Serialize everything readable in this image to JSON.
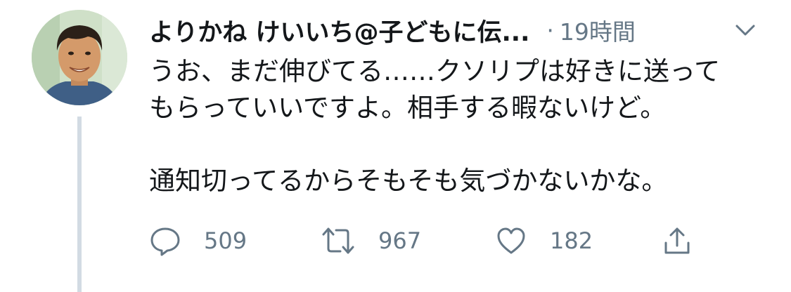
{
  "tweet": {
    "display_name": "よりかね けいいち@子どもに伝...",
    "separator": "·",
    "time": "19時間",
    "text_lines": [
      "うお、まだ伸びてる……クソリプは好きに送って",
      "もらっていいですよ。相手する暇ないけど。"
    ],
    "text_line_3": "通知切ってるからそもそも気づかないかな。"
  },
  "actions": {
    "reply_count": "509",
    "retweet_count": "967",
    "like_count": "182"
  },
  "colors": {
    "text": "#14171a",
    "secondary": "#657786",
    "thread_line": "#d2dbe3"
  },
  "icons": [
    "avatar-photo",
    "chevron-down-icon",
    "reply-icon",
    "retweet-icon",
    "like-icon",
    "share-icon"
  ]
}
